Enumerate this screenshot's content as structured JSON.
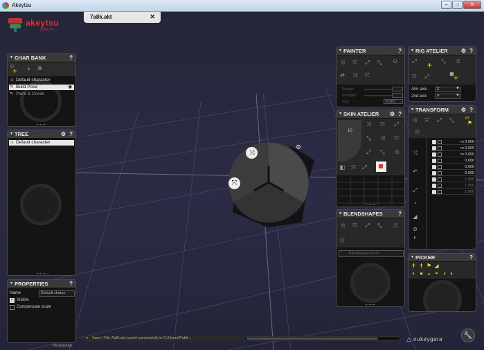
{
  "window": {
    "title": "Akeytsu",
    "btn_min": "–",
    "btn_max": "□",
    "btn_close": "✕"
  },
  "doc_tab": {
    "name": "7a8k.akt",
    "close": "✕"
  },
  "logo": {
    "brand": "akeytsu",
    "version": "2020.3.5"
  },
  "char_bank": {
    "title": "CHAR BANK",
    "help": "?",
    "items": [
      "Default character",
      "Build Pose",
      "Paint & Check"
    ]
  },
  "tree": {
    "title": "TREE",
    "help": "?",
    "items": [
      "Default character"
    ]
  },
  "properties": {
    "title": "PROPERTIES",
    "help": "?",
    "name_label": "Name",
    "name_value": "Default charac",
    "visible_label": "Visible",
    "compensate_label": "Compensate scale"
  },
  "painter": {
    "title": "PAINTER",
    "help": "?",
    "weight_label": "Weight",
    "strength_label": "Strength",
    "size_label": "Size",
    "size_value": "4.000"
  },
  "rig_atelier": {
    "title": "RIG ATELIER",
    "help": "?",
    "aim_axis_label": "Aim axis",
    "aim_axis_value": "Z",
    "second_axis_label": "2nd axis",
    "second_axis_value": "Y"
  },
  "skin_atelier": {
    "title": "SKIN ATELIER",
    "help": "?",
    "value": "10"
  },
  "blendshapes": {
    "title": "BLENDSHAPES",
    "help": "?",
    "mesh_placeholder": "Blendshape mesh"
  },
  "transform": {
    "title": "TRANSFORM",
    "help": "?",
    "axis_tag": "XY",
    "rows": [
      {
        "unit": "m",
        "value": "0.000"
      },
      {
        "unit": "m",
        "value": "0.000"
      },
      {
        "unit": "m",
        "value": "0.000"
      },
      {
        "unit": "",
        "value": "0.000"
      },
      {
        "unit": "",
        "value": "0.000"
      },
      {
        "unit": "",
        "value": "0.000"
      },
      {
        "unit": "",
        "value": "1.000"
      },
      {
        "unit": "",
        "value": "1.000"
      },
      {
        "unit": "",
        "value": "1.000"
      }
    ]
  },
  "picker": {
    "title": "PICKER",
    "help": "?"
  },
  "status": {
    "message": "Save / File 7a8k.akt saved successfully in C:/Users/Publi..."
  },
  "viewport": {
    "camera": "Perspective"
  },
  "footer": {
    "brand": "nukeygara",
    "tool_icon": "wrench-icon"
  },
  "colors": {
    "accent_red": "#e0303a",
    "icon_yellow": "#f0d020",
    "panel_bg": "#141414",
    "viewport_bg": "#2b2b45"
  }
}
